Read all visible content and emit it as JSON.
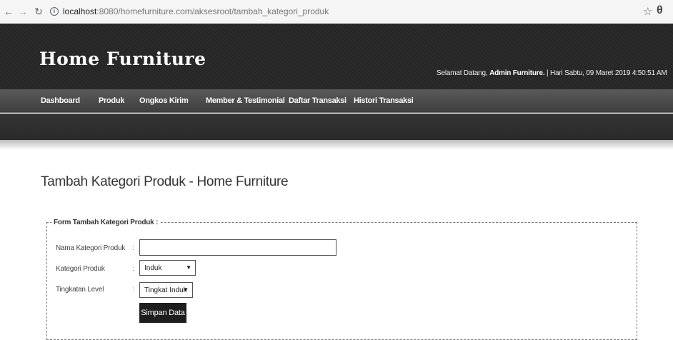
{
  "browser": {
    "url_host": "localhost",
    "url_rest": ":8080/homefurniture.com/aksesroot/tambah_kategori_produk"
  },
  "header": {
    "logo": "Home Furniture",
    "welcome_prefix": "Selamat Datang, ",
    "welcome_user": "Admin Furniture.",
    "welcome_suffix": " | Hari Sabtu, 09 Maret 2019 4:50:51 AM"
  },
  "menu": {
    "dashboard": "Dashboard",
    "produk": "Produk",
    "ongkos_kirim": "Ongkos Kirim",
    "member_testimonial": "Member & Testimonial",
    "daftar_transaksi": "Daftar Transaksi",
    "histori_transaksi": "Histori Transaksi"
  },
  "page": {
    "title": "Tambah Kategori Produk - Home Furniture"
  },
  "form": {
    "legend": "Form Tambah Kategori Produk :",
    "nama_label": "Nama Kategori Produk",
    "nama_value": "",
    "kategori_label": "Kategori Produk",
    "kategori_value": "Induk",
    "level_label": "Tingkatan Level",
    "level_value": "Tingkat Induk",
    "colon": ":",
    "submit_label": "Simpan Data"
  }
}
